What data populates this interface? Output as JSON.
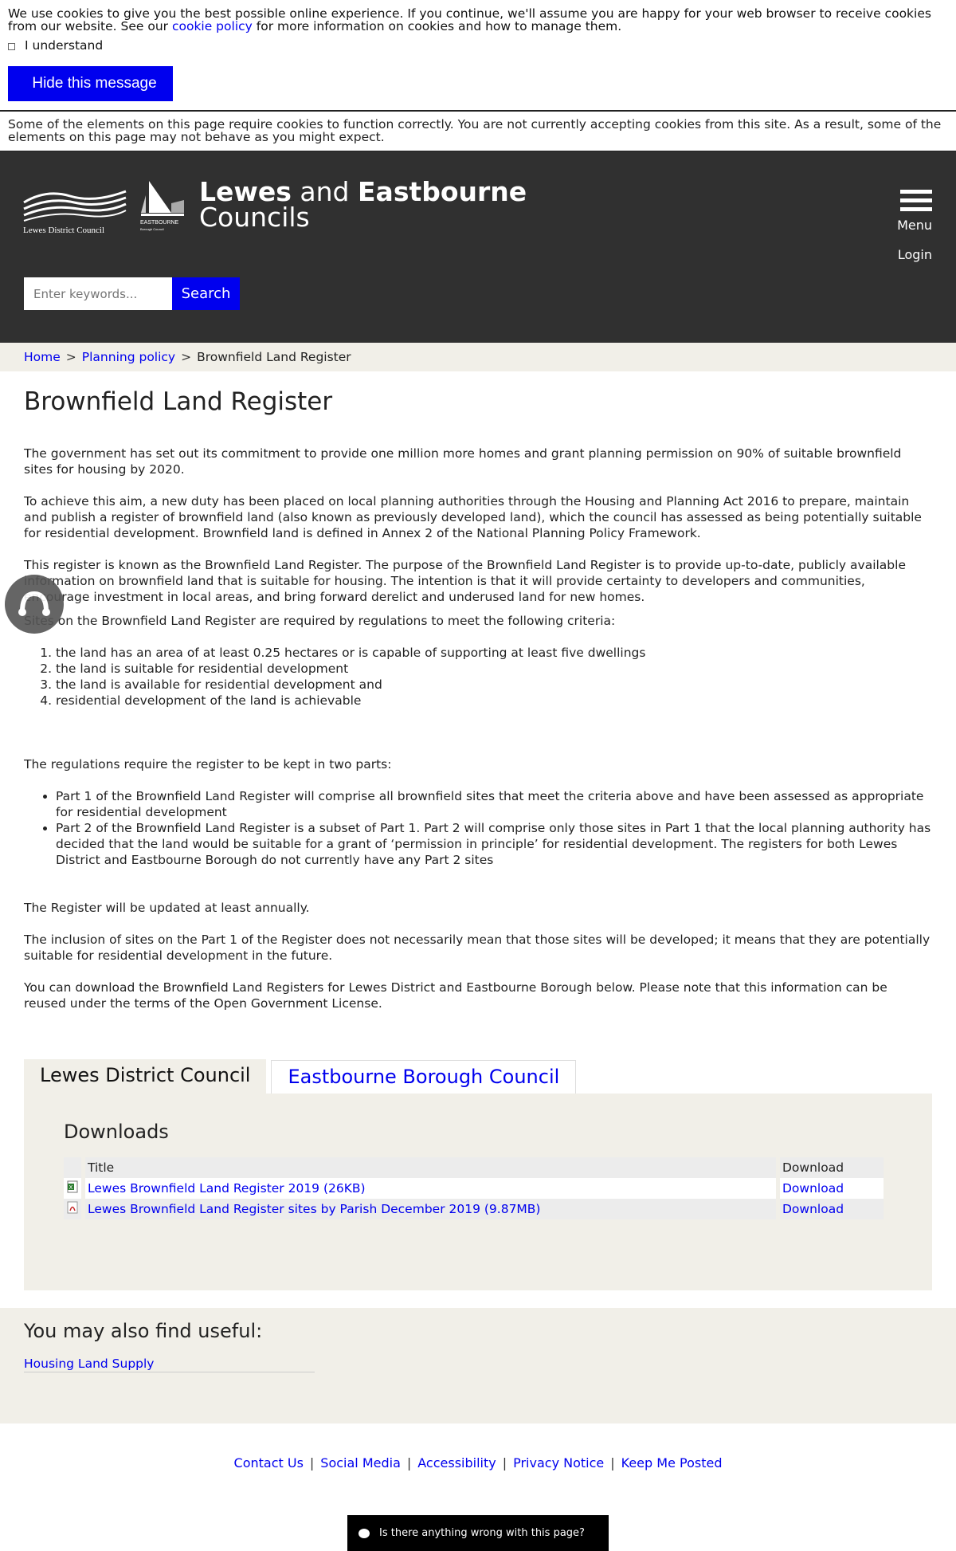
{
  "cookie": {
    "text_before": "We use cookies to give you the best possible online experience. If you continue, we'll assume you are happy for your web browser to receive cookies from our website. See our ",
    "policy_link": "cookie policy",
    "text_after": " for more information on cookies and how to manage them.",
    "understand_label": "I understand",
    "hide_button": "Hide this message",
    "note": "Some of the elements on this page require cookies to function correctly. You are not currently accepting cookies from this site. As a result, some of the elements on this page may not behave as you might expect."
  },
  "header": {
    "logo_lewes_text": "Lewes District Council",
    "logo_east_text": "EASTBOURNE",
    "logo_east_sub": "Borough Council",
    "title_bold1": "Lewes",
    "title_and": "and",
    "title_bold2": "Eastbourne",
    "title_line2": "Councils",
    "menu_label": "Menu",
    "login_label": "Login",
    "search_placeholder": "Enter keywords...",
    "search_button": "Search"
  },
  "breadcrumb": {
    "home": "Home",
    "planning": "Planning policy",
    "current": "Brownfield Land Register",
    "separator": ">"
  },
  "main": {
    "title": "Brownfield Land Register",
    "p1": "The government has set out its commitment to provide one million more homes and grant planning permission on 90% of suitable brownfield sites for housing by 2020.",
    "p2": "To achieve this aim, a new duty has been placed on local planning authorities through the Housing and Planning Act 2016 to prepare, maintain and publish a register of brownfield land (also known as previously developed land), which the council has assessed as being potentially suitable for residential development. Brownfield land is defined in Annex 2 of the National Planning Policy Framework.",
    "p3": "This register is known as the Brownfield Land Register. The purpose of the Brownfield Land Register is to provide up-to-date, publicly available information on brownfield land that is suitable for housing. The intention is that it will provide certainty to developers and communities, encourage investment in local areas, and bring forward derelict and underused land for new homes.",
    "p4": "Sites on the Brownfield Land Register are required by regulations to meet the following criteria:",
    "criteria": [
      "the land has an area of at least 0.25 hectares or is capable of supporting at least five dwellings",
      "the land is suitable for residential development",
      "the land is available for residential development and",
      "residential development of the land is achievable"
    ],
    "p5": "The regulations require the register to be kept in two parts:",
    "parts": [
      "Part 1 of the Brownfield Land Register will comprise all brownfield sites that meet the criteria above and have been assessed as appropriate for residential development",
      "Part 2 of the Brownfield Land Register is a subset of Part 1. Part 2 will comprise only those sites in Part 1 that the local planning authority has decided that the land would be suitable for a grant of ‘permission in principle’ for residential development. The registers for both Lewes District and Eastbourne Borough do not currently have any Part 2 sites"
    ],
    "p6": "The Register will be updated at least annually.",
    "p7": "The inclusion of sites on the Part 1 of the Register does not necessarily mean that those sites will be developed; it means that they are potentially suitable for residential development in the future.",
    "p8": "You can download the Brownfield Land Registers for Lewes District and Eastbourne Borough below. Please note that this information can be reused under the terms of the Open Government License."
  },
  "tabs": {
    "active": "Lewes District Council",
    "inactive": "Eastbourne Borough Council",
    "downloads_title": "Downloads",
    "col_title": "Title",
    "col_download": "Download",
    "rows": [
      {
        "icon": "spreadsheet-icon",
        "title": "Lewes Brownfield Land Register 2019 (26KB)",
        "link": "Download"
      },
      {
        "icon": "pdf-icon",
        "title": "Lewes Brownfield Land Register sites by Parish December 2019 (9.87MB)",
        "link": "Download"
      }
    ]
  },
  "useful": {
    "heading": "You may also find useful:",
    "link": "Housing Land Supply"
  },
  "footer": {
    "links": [
      "Contact Us",
      "Social Media",
      "Accessibility",
      "Privacy Notice",
      "Keep Me Posted"
    ],
    "separator": "|"
  },
  "feedback": {
    "label": "Is there anything wrong with this page?"
  },
  "colors": {
    "header_bg": "#303030",
    "accent": "#0000ee",
    "panel_bg": "#f1efe8"
  }
}
